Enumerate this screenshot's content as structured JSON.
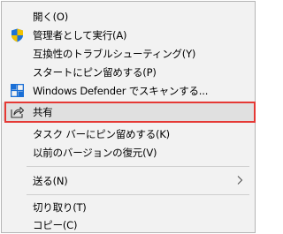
{
  "menu": {
    "items": [
      {
        "label": "開く(O)"
      },
      {
        "label": "管理者として実行(A)",
        "icon": "shield-icon"
      },
      {
        "label": "互換性のトラブルシューティング(Y)"
      },
      {
        "label": "スタートにピン留めする(P)"
      },
      {
        "label": "Windows Defender でスキャンする...",
        "icon": "windows-defender-icon"
      },
      {
        "label": "共有",
        "icon": "share-icon"
      },
      {
        "label": "タスク バーにピン留めする(K)"
      },
      {
        "label": "以前のバージョンの復元(V)"
      },
      {
        "label": "送る(N)",
        "icon": "chevron-right-icon"
      },
      {
        "label": "切り取り(T)"
      },
      {
        "label": "コピー(C)"
      }
    ]
  },
  "colors": {
    "menu_bg": "#f2f2f2",
    "hover_bg": "#e0e0e0",
    "highlight_border": "#e53935",
    "shield_blue": "#1e73d8",
    "shield_yellow": "#f2c200",
    "defender_blue": "#1a6fd6"
  }
}
